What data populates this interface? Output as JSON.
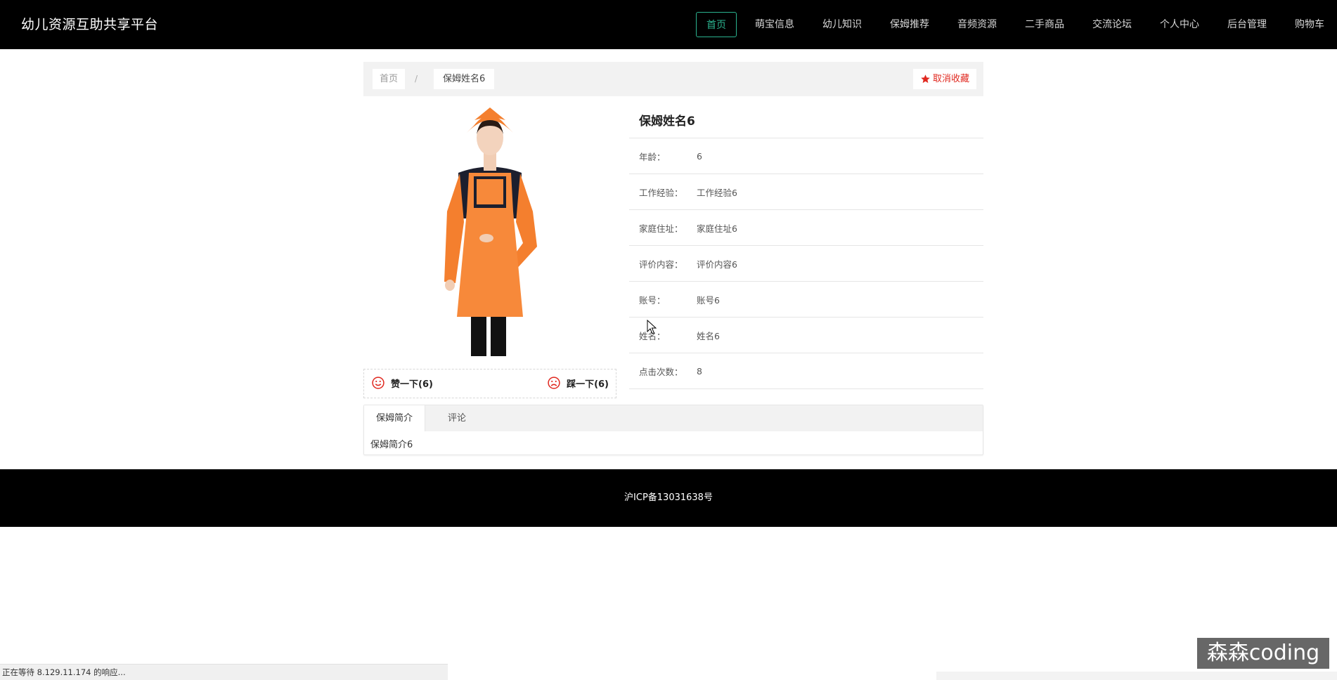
{
  "header": {
    "brand": "幼儿资源互助共享平台",
    "nav": [
      "首页",
      "萌宝信息",
      "幼儿知识",
      "保姆推荐",
      "音频资源",
      "二手商品",
      "交流论坛",
      "个人中心",
      "后台管理",
      "购物车"
    ],
    "active_nav": "首页"
  },
  "breadcrumb": {
    "home": "首页",
    "separator": "/",
    "current": "保姆姓名6"
  },
  "favorite": {
    "label": "取消收藏",
    "icon": "star-icon",
    "color": "#e0281f"
  },
  "product": {
    "photo_icon": "nanny-photo",
    "like_label": "赞一下(6)",
    "dislike_label": "踩一下(6)"
  },
  "details": {
    "title": "保姆姓名6",
    "rows": [
      {
        "label": "年龄：",
        "value": "6"
      },
      {
        "label": "工作经验：",
        "value": "工作经验6"
      },
      {
        "label": "家庭住址：",
        "value": "家庭住址6"
      },
      {
        "label": "评价内容：",
        "value": "评价内容6"
      },
      {
        "label": "账号：",
        "value": "账号6"
      },
      {
        "label": "姓名：",
        "value": "姓名6"
      },
      {
        "label": "点击次数：",
        "value": "8"
      }
    ]
  },
  "tabs": {
    "items": [
      "保姆简介",
      "评论"
    ],
    "active": "保姆简介",
    "content": "保姆简介6"
  },
  "footer": {
    "text": "沪ICP备13031638号"
  },
  "status_bar": {
    "text": "正在等待 8.129.11.174 的响应..."
  },
  "watermark": {
    "text": "森森coding"
  },
  "colors": {
    "accent": "#2bb38f",
    "header_bg": "#000000",
    "favorite": "#e0281f"
  }
}
